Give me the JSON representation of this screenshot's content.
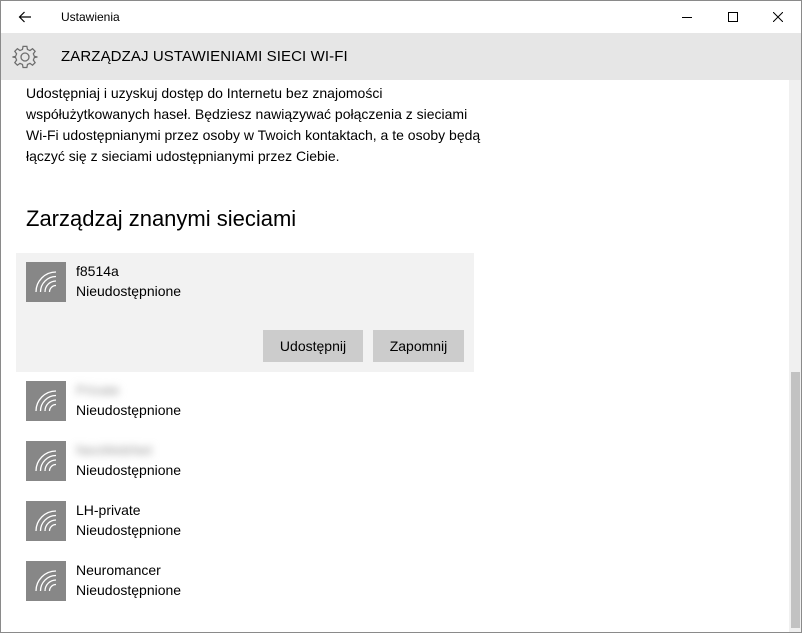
{
  "window": {
    "title": "Ustawienia"
  },
  "header": {
    "title": "ZARZĄDZAJ USTAWIENIAMI SIECI WI-FI"
  },
  "description": "Udostępniaj i uzyskuj dostęp do Internetu bez znajomości współużytkowanych haseł. Będziesz nawiązywać połączenia z sieciami Wi-Fi udostępnianymi przez osoby w Twoich kontaktach, a te osoby będą łączyć się z sieciami udostępnianymi przez Ciebie.",
  "known_networks": {
    "title": "Zarządzaj znanymi sieciami",
    "share_button": "Udostępnij",
    "forget_button": "Zapomnij",
    "items": [
      {
        "name": "f8514a",
        "status": "Nieudostępnione",
        "selected": true
      },
      {
        "name": "Private",
        "status": "Nieudostępnione",
        "blurred": true
      },
      {
        "name": "NeoWebNet",
        "status": "Nieudostępnione",
        "blurred": true
      },
      {
        "name": "LH-private",
        "status": "Nieudostępnione"
      },
      {
        "name": "Neuromancer",
        "status": "Nieudostępnione"
      }
    ]
  },
  "icons": {
    "back": "back-arrow-icon",
    "settings": "gear-icon",
    "network": "wifi-icon",
    "minimize": "minimize-icon",
    "maximize": "maximize-icon",
    "close": "close-icon"
  },
  "colors": {
    "header_bg": "#e6e6e6",
    "selected_bg": "#f2f2f2",
    "button_bg": "#cccccc",
    "wifi_tile": "#878787"
  }
}
